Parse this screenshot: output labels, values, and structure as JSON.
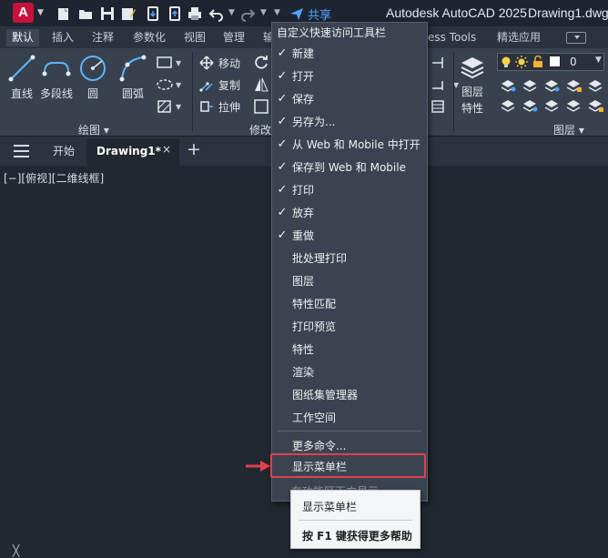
{
  "titlebar": {
    "app_logo": "A",
    "share": "共享",
    "window_title": "Autodesk AutoCAD 2025",
    "doc_name": "Drawing1.dwg",
    "icons": [
      "new-icon",
      "open-icon",
      "save-icon",
      "save-as-icon",
      "web-mobile-icon",
      "plot-icon",
      "undo-icon",
      "redo-icon",
      "share-icon"
    ]
  },
  "ribbon": {
    "tabs": [
      "默认",
      "插入",
      "注释",
      "参数化",
      "视图",
      "管理",
      "输",
      "ess Tools",
      "精选应用"
    ],
    "active_tab": "默认",
    "draw_tools": [
      "直线",
      "多段线",
      "圆",
      "圆弧"
    ],
    "draw_panel_title": "绘图 ▾",
    "modify_tools": [
      "移动",
      "复制",
      "拉伸"
    ],
    "modify_panel_title": "修改",
    "layer_tools": [
      "图层",
      "特性"
    ],
    "layer_panel_title": "图层 ▾",
    "layer_value": "0"
  },
  "filetabs": {
    "start": "开始",
    "drawing": "Drawing1*",
    "close": "×",
    "add": "+"
  },
  "viewport": {
    "label": "[−][俯视][二维线框]",
    "ucs_mark": "╳"
  },
  "menu": {
    "title": "自定义快速访问工具栏",
    "items": [
      {
        "label": "新建",
        "checked": true
      },
      {
        "label": "打开",
        "checked": true
      },
      {
        "label": "保存",
        "checked": true
      },
      {
        "label": "另存为...",
        "checked": true
      },
      {
        "label": "从 Web 和 Mobile 中打开",
        "checked": true
      },
      {
        "label": "保存到 Web 和 Mobile",
        "checked": true
      },
      {
        "label": "打印",
        "checked": true
      },
      {
        "label": "放弃",
        "checked": true
      },
      {
        "label": "重做",
        "checked": true
      },
      {
        "label": "批处理打印",
        "checked": false
      },
      {
        "label": "图层",
        "checked": false
      },
      {
        "label": "特性匹配",
        "checked": false
      },
      {
        "label": "打印预览",
        "checked": false
      },
      {
        "label": "特性",
        "checked": false
      },
      {
        "label": "渲染",
        "checked": false
      },
      {
        "label": "图纸集管理器",
        "checked": false
      },
      {
        "label": "工作空间",
        "checked": false
      }
    ],
    "more_commands": "更多命令...",
    "show_menubar": "显示菜单栏",
    "partial_item": "在功能区下方显示",
    "check_glyph": "✓"
  },
  "tooltip": {
    "title": "显示菜单栏",
    "help": "按 F1 键获得更多帮助"
  },
  "colors": {
    "accent_red": "#e0414d",
    "logo_red": "#c9113b",
    "share_blue": "#4fa3ff"
  }
}
